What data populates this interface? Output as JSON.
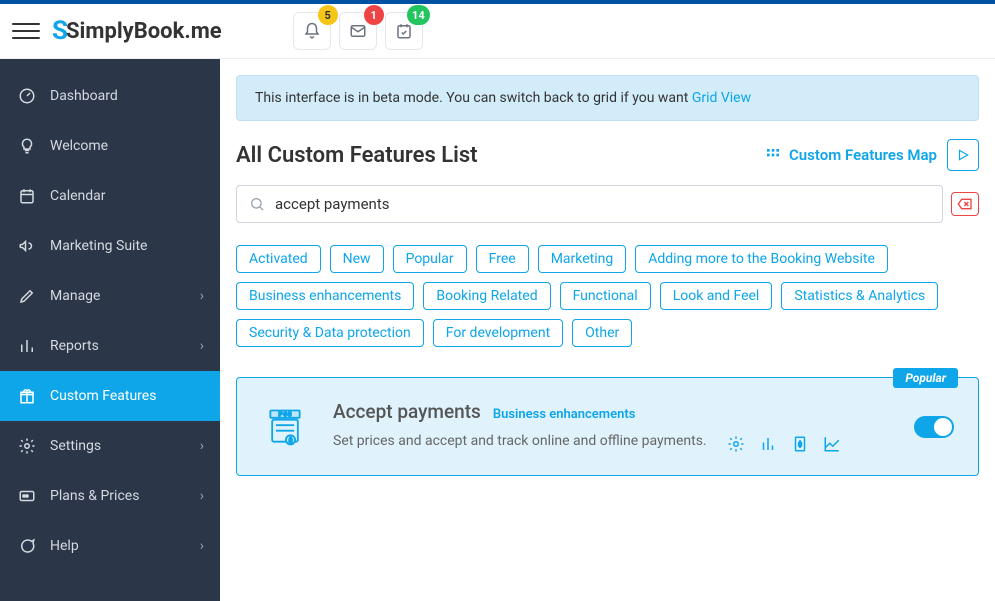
{
  "header": {
    "logo_primary": "SimplyBook",
    "logo_suffix": ".me",
    "notifs": {
      "bell": "5",
      "mail": "1",
      "cal": "14"
    }
  },
  "sidebar": {
    "items": [
      {
        "label": "Dashboard",
        "icon": "gauge",
        "caret": false
      },
      {
        "label": "Welcome",
        "icon": "bulb",
        "caret": false
      },
      {
        "label": "Calendar",
        "icon": "calendar",
        "caret": false
      },
      {
        "label": "Marketing Suite",
        "icon": "megaphone",
        "caret": false
      },
      {
        "label": "Manage",
        "icon": "pencil",
        "caret": true
      },
      {
        "label": "Reports",
        "icon": "bars",
        "caret": true
      },
      {
        "label": "Custom Features",
        "icon": "gift",
        "caret": false,
        "active": true
      },
      {
        "label": "Settings",
        "icon": "gear",
        "caret": true
      },
      {
        "label": "Plans & Prices",
        "icon": "card",
        "caret": true
      },
      {
        "label": "Help",
        "icon": "chat",
        "caret": true
      }
    ]
  },
  "banner": {
    "text": "This interface is in beta mode. You can switch back to grid if you want ",
    "link": "Grid View"
  },
  "page": {
    "title": "All Custom Features List",
    "map_link": "Custom Features Map"
  },
  "search": {
    "value": "accept payments"
  },
  "filters": [
    "Activated",
    "New",
    "Popular",
    "Free",
    "Marketing",
    "Adding more to the Booking Website",
    "Business enhancements",
    "Booking Related",
    "Functional",
    "Look and Feel",
    "Statistics & Analytics",
    "Security & Data protection",
    "For development",
    "Other"
  ],
  "feature": {
    "badge": "Popular",
    "title": "Accept payments",
    "category": "Business enhancements",
    "desc": "Set prices and accept and track online and offline payments.",
    "enabled": true
  }
}
